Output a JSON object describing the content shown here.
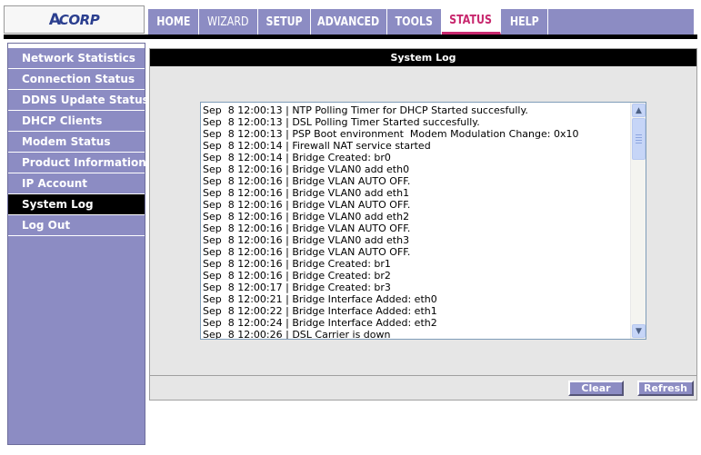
{
  "logo": {
    "text": "CORP",
    "mark": "A"
  },
  "topnav": {
    "tabs": [
      {
        "label": "HOME"
      },
      {
        "label": "WIZARD"
      },
      {
        "label": "SETUP"
      },
      {
        "label": "ADVANCED"
      },
      {
        "label": "TOOLS"
      },
      {
        "label": "STATUS"
      },
      {
        "label": "HELP"
      }
    ],
    "active_tab": "STATUS"
  },
  "sidebar": {
    "items": [
      {
        "label": "Network Statistics"
      },
      {
        "label": "Connection Status"
      },
      {
        "label": "DDNS Update Status"
      },
      {
        "label": "DHCP Clients"
      },
      {
        "label": "Modem Status"
      },
      {
        "label": "Product Information"
      },
      {
        "label": "IP Account"
      },
      {
        "label": "System Log"
      },
      {
        "label": "Log Out"
      }
    ],
    "active_item": "System Log"
  },
  "main": {
    "title": "System Log",
    "log_lines": [
      "Sep  8 12:00:13 | NTP Polling Timer for DHCP Started succesfully.",
      "Sep  8 12:00:13 | DSL Polling Timer Started succesfully.",
      "Sep  8 12:00:13 | PSP Boot environment  Modem Modulation Change: 0x10",
      "Sep  8 12:00:14 | Firewall NAT service started",
      "Sep  8 12:00:14 | Bridge Created: br0",
      "Sep  8 12:00:16 | Bridge VLAN0 add eth0",
      "Sep  8 12:00:16 | Bridge VLAN AUTO OFF.",
      "Sep  8 12:00:16 | Bridge VLAN0 add eth1",
      "Sep  8 12:00:16 | Bridge VLAN AUTO OFF.",
      "Sep  8 12:00:16 | Bridge VLAN0 add eth2",
      "Sep  8 12:00:16 | Bridge VLAN AUTO OFF.",
      "Sep  8 12:00:16 | Bridge VLAN0 add eth3",
      "Sep  8 12:00:16 | Bridge VLAN AUTO OFF.",
      "Sep  8 12:00:16 | Bridge Created: br1",
      "Sep  8 12:00:16 | Bridge Created: br2",
      "Sep  8 12:00:17 | Bridge Created: br3",
      "Sep  8 12:00:21 | Bridge Interface Added: eth0",
      "Sep  8 12:00:22 | Bridge Interface Added: eth1",
      "Sep  8 12:00:24 | Bridge Interface Added: eth2",
      "Sep  8 12:00:26 | DSL Carrier is down"
    ],
    "buttons": {
      "clear": "Clear",
      "refresh": "Refresh"
    }
  },
  "colors": {
    "nav": "#8c8cc3",
    "active_tab_accent": "#c8286e",
    "header_bar": "#000000",
    "panel_bg": "#e6e6e6"
  }
}
